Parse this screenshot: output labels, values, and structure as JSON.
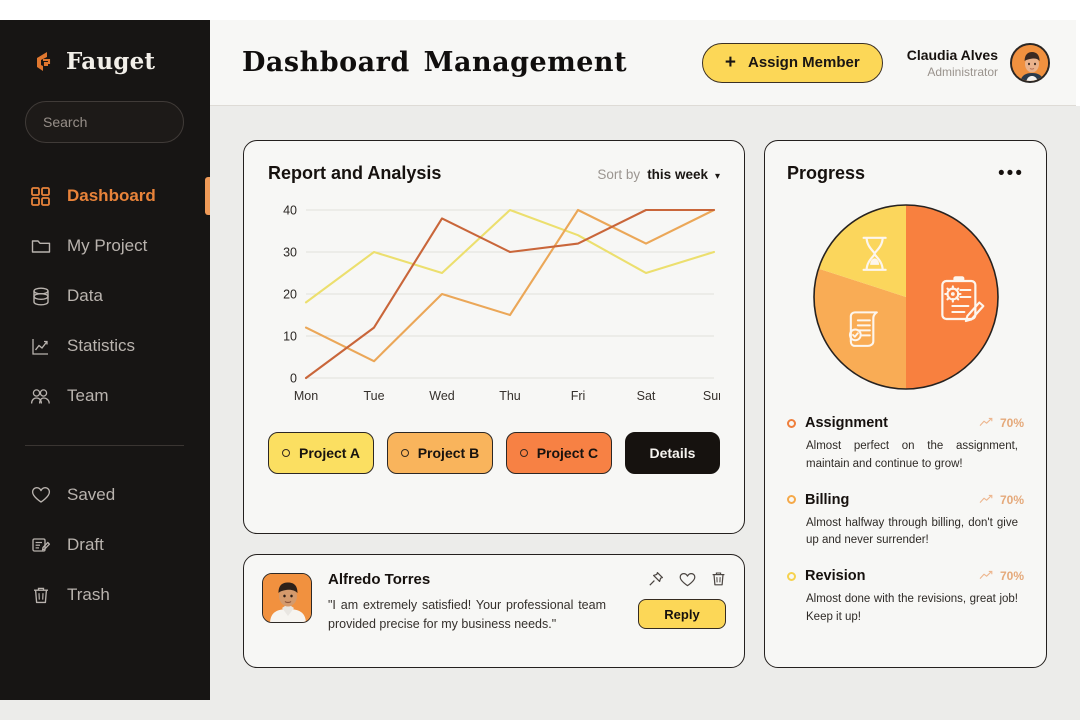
{
  "brand": {
    "name": "Fauget",
    "logo_icon": "fauget-logo-icon"
  },
  "sidebar": {
    "search": {
      "placeholder": "Search",
      "value": "",
      "icon": "search-icon"
    },
    "items": [
      {
        "label": "Dashboard",
        "icon": "grid-icon",
        "active": true
      },
      {
        "label": "My Project",
        "icon": "folder-icon",
        "active": false
      },
      {
        "label": "Data",
        "icon": "database-icon",
        "active": false
      },
      {
        "label": "Statistics",
        "icon": "line-chart-icon",
        "active": false
      },
      {
        "label": "Team",
        "icon": "people-icon",
        "active": false
      }
    ],
    "lower_items": [
      {
        "label": "Saved",
        "icon": "heart-icon"
      },
      {
        "label": "Draft",
        "icon": "draft-edit-icon"
      },
      {
        "label": "Trash",
        "icon": "trash-icon"
      }
    ]
  },
  "header": {
    "title": "Dashboard Management",
    "assign_button": {
      "label": "Assign Member",
      "icon": "plus-icon"
    },
    "user": {
      "name": "Claudia Alves",
      "role": "Administrator",
      "avatar": "user-avatar"
    }
  },
  "report_card": {
    "title": "Report and Analysis",
    "sort": {
      "label": "Sort by",
      "value": "this week",
      "caret": "▾"
    },
    "projects": [
      {
        "label": "Project A",
        "color": "#fbdf61"
      },
      {
        "label": "Project B",
        "color": "#f9b45c"
      },
      {
        "label": "Project C",
        "color": "#f78144"
      }
    ],
    "details_button": "Details"
  },
  "chart_data": {
    "type": "line",
    "title": "Report and Analysis",
    "xlabel": "",
    "ylabel": "",
    "categories": [
      "Mon",
      "Tue",
      "Wed",
      "Thu",
      "Fri",
      "Sat",
      "Sun"
    ],
    "ylim": [
      0,
      40
    ],
    "yticks": [
      0,
      10,
      20,
      30,
      40
    ],
    "grid": true,
    "legend_position": "below-chart",
    "series": [
      {
        "name": "Project A",
        "color": "#ecdf6e",
        "values": [
          18,
          30,
          25,
          40,
          34,
          25,
          30
        ]
      },
      {
        "name": "Project B",
        "color": "#eba758",
        "values": [
          12,
          4,
          20,
          15,
          40,
          32,
          40
        ]
      },
      {
        "name": "Project C",
        "color": "#c9663a",
        "values": [
          0,
          12,
          38,
          30,
          32,
          40,
          40
        ]
      }
    ]
  },
  "testimonial": {
    "name": "Alfredo Torres",
    "quote": "\"I am extremely satisfied! Your professional team provided precise for my business needs.\"",
    "actions": [
      "pin-icon",
      "heart-icon",
      "trash-icon"
    ],
    "reply_button": "Reply",
    "avatar": "alfredo-avatar"
  },
  "progress": {
    "title": "Progress",
    "menu_icon": "•••",
    "pie": {
      "type": "pie",
      "slices": [
        {
          "name": "Assignment",
          "value": 50,
          "color": "#f8803f",
          "icon": "clipboard-gear-icon"
        },
        {
          "name": "Billing",
          "value": 30,
          "color": "#f9ac55",
          "icon": "document-check-icon"
        },
        {
          "name": "Revision",
          "value": 20,
          "color": "#fbd65c",
          "icon": "hourglass-icon"
        }
      ]
    },
    "items": [
      {
        "name": "Assignment",
        "pct": "70%",
        "bullet": "#ef7f3c",
        "desc": "Almost perfect on the assignment, maintain and continue to grow!"
      },
      {
        "name": "Billing",
        "pct": "70%",
        "bullet": "#f5a949",
        "desc": "Almost halfway through billing, don't give up and never surrender!"
      },
      {
        "name": "Revision",
        "pct": "70%",
        "bullet": "#f6d24f",
        "desc": "Almost done with the revisions, great job! Keep it up!"
      }
    ]
  }
}
